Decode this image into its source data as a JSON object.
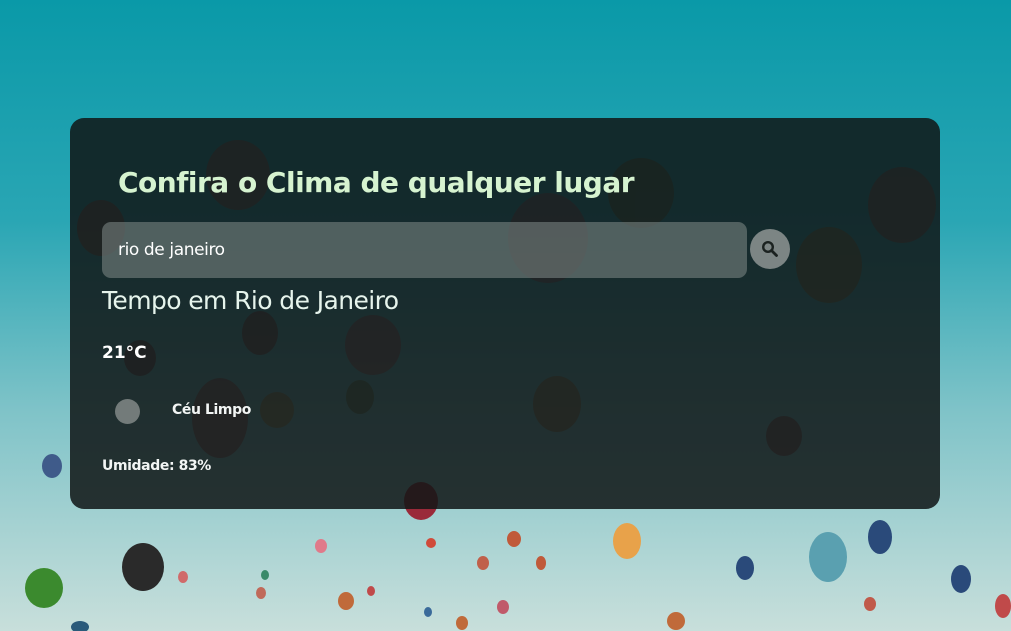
{
  "header": {
    "title": "Confira o Clima de qualquer lugar"
  },
  "search": {
    "value": "rio de janeiro",
    "placeholder": ""
  },
  "search_button": {
    "icon": "search-icon"
  },
  "weather": {
    "city_heading": "Tempo em Rio de Janeiro",
    "temperature": "21°C",
    "condition_icon": "weather-condition-icon",
    "condition": "Céu Limpo",
    "humidity": "Umidade: 83%"
  },
  "colors": {
    "title": "#d6f3d0",
    "card_background": "#101616",
    "search_background": "#7c8684",
    "button": "#7c8584"
  }
}
